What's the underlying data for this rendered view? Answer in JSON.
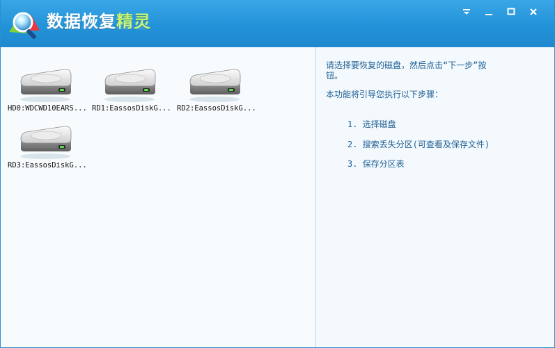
{
  "app": {
    "title_main": "数据恢复",
    "title_accent": "精灵"
  },
  "window_controls": {
    "menu_icon": "dropdown-arrow-icon",
    "minimize_icon": "minimize-icon",
    "maximize_icon": "maximize-icon",
    "close_icon": "close-icon"
  },
  "disks": [
    {
      "label": "HD0:WDCWD10EARS...",
      "icon": "hard-disk-icon"
    },
    {
      "label": "RD1:EassosDiskG...",
      "icon": "hard-disk-icon"
    },
    {
      "label": "RD2:EassosDiskG...",
      "icon": "hard-disk-icon"
    },
    {
      "label": "RD3:EassosDiskG...",
      "icon": "hard-disk-icon"
    }
  ],
  "info": {
    "line1": "请选择要恢复的磁盘，然后点击“下一步”按",
    "line2": "钮。",
    "line3": "本功能将引导您执行以下步骤：",
    "steps": [
      "1. 选择磁盘",
      "2. 搜索丢失分区(可查看及保存文件)",
      "3. 保存分区表"
    ]
  },
  "colors": {
    "titlebar": "#2393d9",
    "title_accent": "#c6f56b",
    "info_text": "#1f5f93",
    "background": "#f3f9fd"
  }
}
